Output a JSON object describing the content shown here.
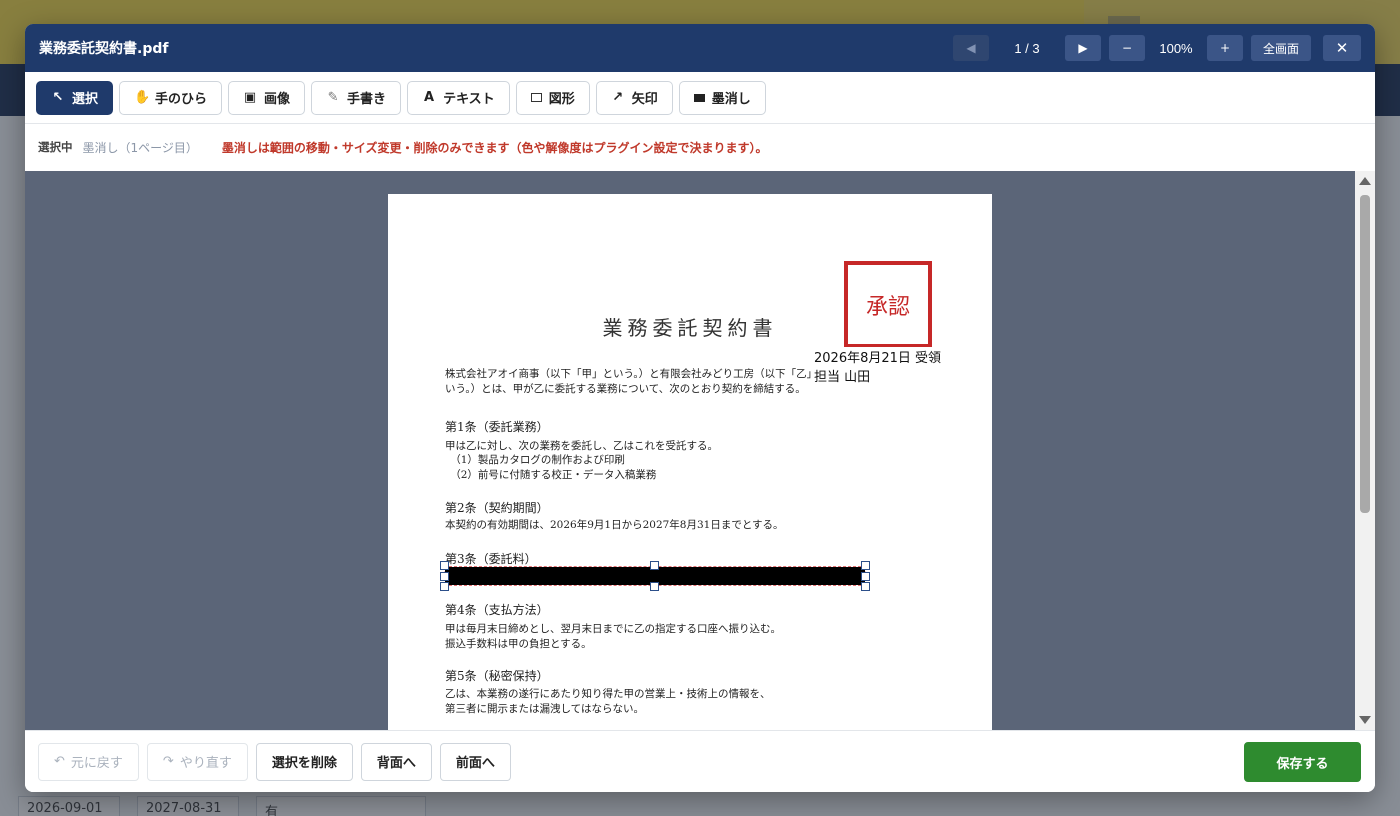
{
  "background": {
    "fields": [
      "2026-09-01",
      "2027-08-31",
      "有"
    ]
  },
  "modal": {
    "title": "業務委託契約書.pdf",
    "pager": {
      "prev_icon": "◀",
      "next_icon": "▶",
      "label": "1 / 3"
    },
    "zoom": {
      "minus": "−",
      "value": "100%",
      "plus": "+"
    },
    "fullscreen": "全画面",
    "close_icon": "✕"
  },
  "tools": [
    {
      "icon": "↖",
      "label": "選択",
      "active": true
    },
    {
      "icon": "✋",
      "label": "手のひら"
    },
    {
      "icon": "▣",
      "label": "画像"
    },
    {
      "icon": "✎",
      "label": "手書き"
    },
    {
      "icon": "A",
      "label": "テキスト"
    },
    {
      "icon": "square",
      "label": "図形"
    },
    {
      "icon": "↗",
      "label": "矢印"
    },
    {
      "icon": "block",
      "label": "墨消し"
    }
  ],
  "status": {
    "label": "選択中",
    "selection": "墨消し（1ページ目）",
    "message": "墨消しは範囲の移動・サイズ変更・削除のみできます（色や解像度はプラグイン設定で決まります）。"
  },
  "document": {
    "title": "業務委託契約書",
    "intro1": "株式会社アオイ商事（以下「甲」という。）と有限会社みどり工房（以下「乙」と",
    "intro2": "いう。）とは、甲が乙に委託する業務について、次のとおり契約を締結する。",
    "art1_h": "第1条（委託業務）",
    "art1_p1": "甲は乙に対し、次の業務を委託し、乙はこれを受託する。",
    "art1_p2": "　（1）製品カタログの制作および印刷",
    "art1_p3": "　（2）前号に付随する校正・データ入稿業務",
    "art2_h": "第2条（契約期間）",
    "art2_p1": "本契約の有効期間は、2026年9月1日から2027年8月31日までとする。",
    "art3_h": "第3条（委託料）",
    "art4_h": "第4条（支払方法）",
    "art4_p1": "甲は毎月末日締めとし、翌月末日までに乙の指定する口座へ振り込む。",
    "art4_p2": "振込手数料は甲の負担とする。",
    "art5_h": "第5条（秘密保持）",
    "art5_p1": "乙は、本業務の遂行にあたり知り得た甲の営業上・技術上の情報を、",
    "art5_p2": "第三者に開示または漏洩してはならない。",
    "stamp": "承認",
    "stamp_date": "2026年8月21日 受領",
    "stamp_person": "担当 山田"
  },
  "footer": {
    "undo": "元に戻す",
    "redo": "やり直す",
    "undo_icon": "↶",
    "redo_icon": "↷",
    "delete": "選択を削除",
    "to_back": "背面へ",
    "to_front": "前面へ",
    "save": "保存する"
  }
}
